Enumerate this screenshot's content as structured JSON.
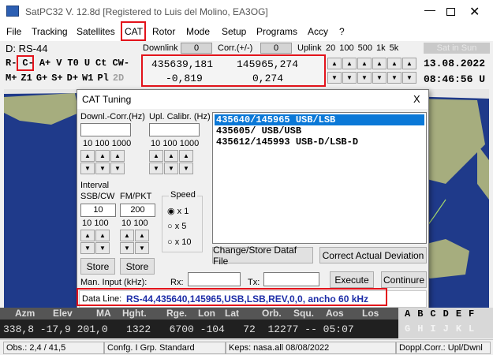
{
  "window": {
    "title": "SatPC32 V. 12.8d   [Registered to Luis del Molino, EA3OG]"
  },
  "menu": [
    "File",
    "Tracking",
    "Satellites",
    "CAT",
    "Rotor",
    "Mode",
    "Setup",
    "Programs",
    "Accy",
    "?"
  ],
  "sat_name": "D: RS-44",
  "downlink": {
    "label": "Downlink",
    "value": "0"
  },
  "corr": {
    "label": "Corr.(+/-)",
    "value": "0"
  },
  "uplink": {
    "label": "Uplink",
    "steps": [
      "20",
      "100",
      "500",
      "1k",
      "5k"
    ]
  },
  "sun_status": "Sat in Sun",
  "row_a": [
    "R-",
    "C-",
    "A+",
    "V",
    "T0",
    "U",
    "Ct",
    "CW-"
  ],
  "row_b": [
    "M+",
    "Z1",
    "G+",
    "S+",
    "D+",
    "W1",
    "Pl",
    "2D"
  ],
  "freq": {
    "down": "435639,181",
    "up": "145965,274",
    "dop_down": "-0,819",
    "dop_up": "0,274"
  },
  "date": "13.08.2022",
  "time": "08:46:56 U",
  "dialog": {
    "title": "CAT Tuning",
    "close": "X",
    "downl_corr": "Downl.-Corr.(Hz)",
    "upl_calib": "Upl. Calibr. (Hz)",
    "steps3": [
      "10",
      "100",
      "1000"
    ],
    "interval": "Interval",
    "ssb_cw": "SSB/CW",
    "fm_pkt": "FM/PKT",
    "ssb_val": "10",
    "fm_val": "200",
    "steps2": [
      "10",
      "100"
    ],
    "speed": "Speed",
    "speed_opts": [
      "x  1",
      "x  5",
      "x 10"
    ],
    "store": "Store",
    "list": [
      "435640/145965 USB/LSB",
      "435605/ USB/USB",
      "435612/145993 USB-D/LSB-D"
    ],
    "change_store": "Change/Store Dataf File",
    "correct_dev": "Correct Actual Deviation",
    "man_input": "Man. Input (kHz):",
    "rx": "Rx:",
    "tx": "Tx:",
    "execute": "Execute",
    "continue": "Continure",
    "data_line_label": "Data Line:",
    "data_line": "RS-44,435640,145965,USB,LSB,REV,0,0, ancho 60 kHz"
  },
  "table": {
    "headers": [
      "Azm",
      "Elev",
      "MA",
      "Hght.",
      "Rge.",
      "Lon",
      "Lat",
      "Orb.",
      "Squ.",
      "Aos",
      "Los"
    ],
    "values": "338,8 -17,9 201,0   1322   6700 -104   72  12277 -- 05:07"
  },
  "letters_a": [
    "A",
    "B",
    "C",
    "D",
    "E",
    "F"
  ],
  "letters_b": [
    "G",
    "H",
    "I",
    "J",
    "K",
    "L"
  ],
  "status": {
    "obs": "Obs.: 2,4 / 41,5",
    "conf": "Confg. I  Grp. Standard",
    "keps": "Keps: nasa.all 08/08/2022",
    "doppl": "Doppl.Corr.: Upl/Dwnl"
  }
}
